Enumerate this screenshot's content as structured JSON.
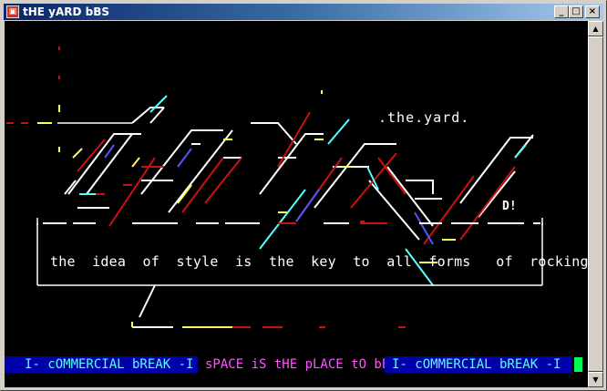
{
  "window": {
    "title": "tHE yARD bBS",
    "icon": "terminal-app-icon",
    "controls": {
      "minimize": "_",
      "maximize": "□",
      "close": "×"
    }
  },
  "ansi": {
    "header": ".the.yard.",
    "tag": "D!",
    "slogan": "the  idea  of  style  is  the  key  to  all  forms   of  rocking"
  },
  "statusbar": {
    "left": "I- cOMMERCIAL bREAK -I",
    "middle": "sPACE iS tHE pLACE tO bE",
    "right": "I- cOMMERCIAL bREAK -I"
  },
  "colors": {
    "cyan": "#55ffff",
    "magenta": "#ff55ff",
    "blue_bg": "#0000aa",
    "red": "#cc1111",
    "yellow": "#ffff55",
    "cursor": "#00ff55"
  }
}
